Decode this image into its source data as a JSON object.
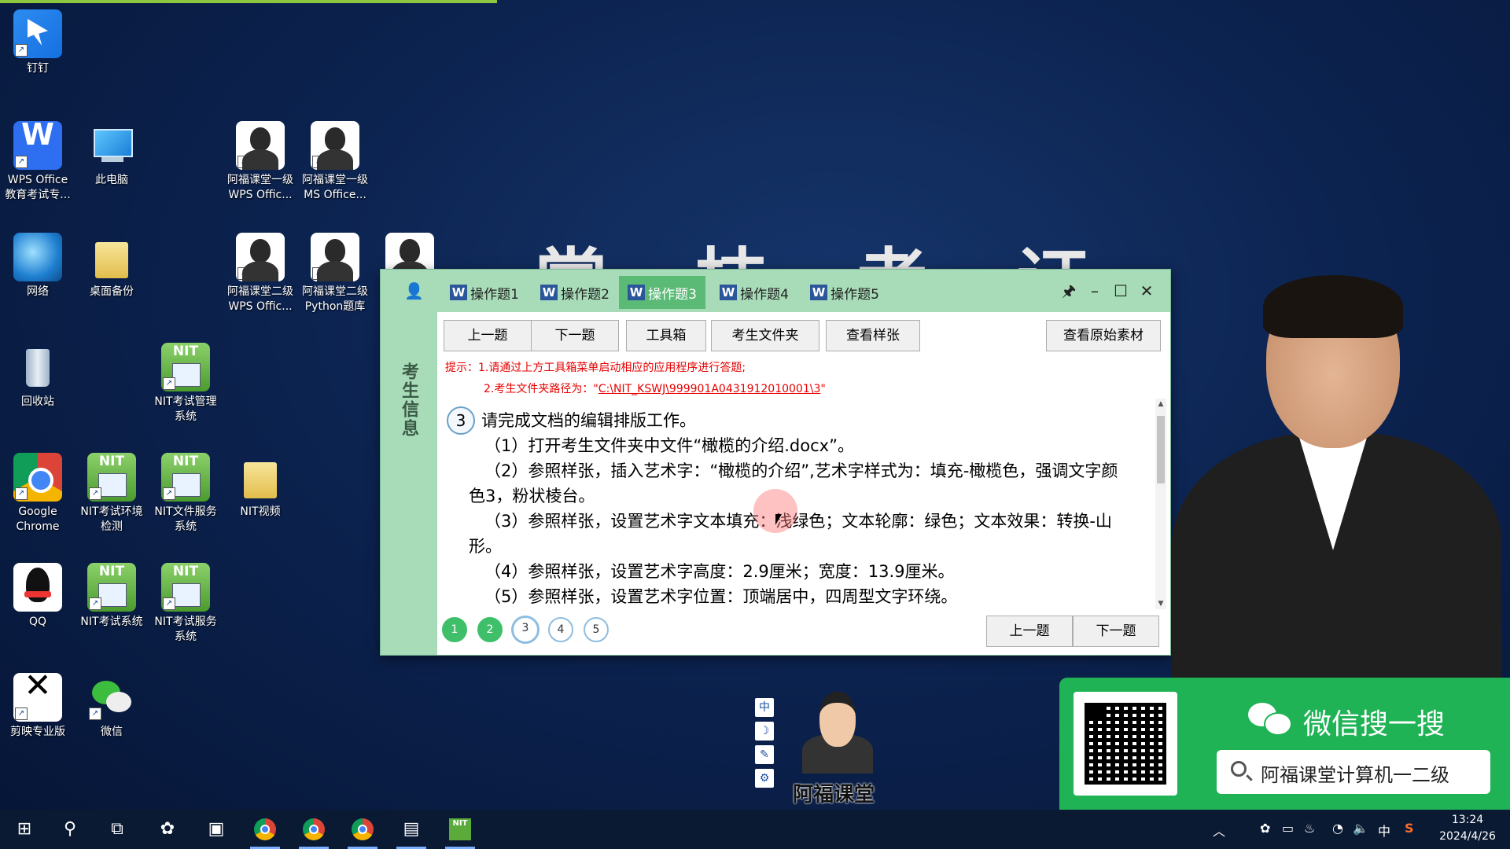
{
  "desktop": {
    "bg_title": "掌 技 考 证",
    "icons": [
      {
        "label": "钉钉"
      },
      {
        "label": "WPS Office\n教育考试专..."
      },
      {
        "label": "此电脑"
      },
      {
        "label": "阿福课堂一级\nWPS Offic..."
      },
      {
        "label": "阿福课堂一级\nMS Office..."
      },
      {
        "label": "网络"
      },
      {
        "label": "桌面备份"
      },
      {
        "label": "阿福课堂二级\nWPS Offic..."
      },
      {
        "label": "阿福课堂二级\nPython题库"
      },
      {
        "label": "回收站"
      },
      {
        "label": "NIT考试管理\n系统"
      },
      {
        "label": "Google\nChrome"
      },
      {
        "label": "NIT考试环境\n检测"
      },
      {
        "label": "NIT文件服务\n系统"
      },
      {
        "label": "NIT视频"
      },
      {
        "label": "QQ"
      },
      {
        "label": "NIT考试系统"
      },
      {
        "label": "NIT考试服务\n系统"
      },
      {
        "label": "剪映专业版"
      },
      {
        "label": "微信"
      }
    ]
  },
  "exam_window": {
    "tabs": [
      {
        "label": "操作题1",
        "active": false
      },
      {
        "label": "操作题2",
        "active": false
      },
      {
        "label": "操作题3",
        "active": true
      },
      {
        "label": "操作题4",
        "active": false
      },
      {
        "label": "操作题5",
        "active": false
      }
    ],
    "controls": {
      "pin": "🖈",
      "minimize": "–",
      "maximize": "☐",
      "close": "✕"
    },
    "side_label": "考生信息",
    "toolbar": {
      "prev": "上一题",
      "next": "下一题",
      "toolbox": "工具箱",
      "folder": "考生文件夹",
      "sample": "查看样张",
      "original": "查看原始素材"
    },
    "hints": {
      "line1": "提示：1.请通过上方工具箱菜单启动相应的应用程序进行答题;",
      "line2_prefix": "2.考生文件夹路径为：\"",
      "line2_path": "C:\\NIT_KSWJ\\999901A0431912010001\\3",
      "line2_suffix": "\""
    },
    "question": {
      "number": "3",
      "title": "请完成文档的编辑排版工作。",
      "items": [
        "（1）打开考生文件夹中文件“橄榄的介绍.docx”。",
        "（2）参照样张，插入艺术字：“橄榄的介绍”,艺术字样式为：填充-橄榄色，强调文字颜色3，粉状棱台。",
        "（3）参照样张，设置艺术字文本填充：浅绿色；文本轮廓：绿色；文本效果：转换-山形。",
        "（4）参照样张，设置艺术字高度：2.9厘米；宽度：13.9厘米。",
        "（5）参照样张，设置艺术字位置：顶端居中，四周型文字环绕。"
      ]
    },
    "pager": [
      {
        "num": "1",
        "state": "done"
      },
      {
        "num": "2",
        "state": "done"
      },
      {
        "num": "3",
        "state": "cur"
      },
      {
        "num": "4",
        "state": "todo"
      },
      {
        "num": "5",
        "state": "todo"
      }
    ],
    "bottom": {
      "prev": "上一题",
      "next": "下一题"
    }
  },
  "overlay": {
    "ime": [
      "中",
      "☽",
      "✎",
      "⚙"
    ],
    "brand": "阿福课堂",
    "wechat_title": "微信搜一搜",
    "wechat_search": "阿福课堂计算机一二级"
  },
  "taskbar": {
    "tray": {
      "chevron": "︿",
      "ime": "中",
      "antivirus": "S"
    },
    "time": "13:24",
    "date": "2024/4/26"
  },
  "colors": {
    "window_green": "#a8dcb8",
    "active_tab": "#5aba76",
    "hint_red": "#e60000",
    "wechat_green": "#1fb356",
    "desktop_bg": "#0c2350"
  }
}
